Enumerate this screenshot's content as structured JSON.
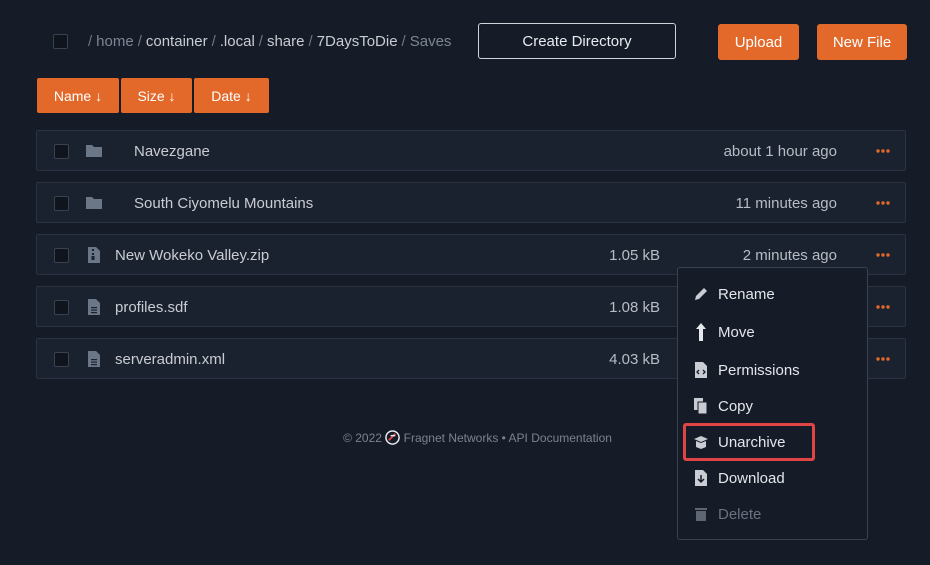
{
  "breadcrumb": {
    "sep": "/",
    "segments": [
      "home",
      "container",
      ".local",
      "share",
      "7DaysToDie",
      "Saves"
    ]
  },
  "toolbar": {
    "create_directory": "Create Directory",
    "upload": "Upload",
    "new_file": "New File"
  },
  "sort": {
    "name": "Name ↓",
    "size": "Size ↓",
    "date": "Date ↓"
  },
  "files": [
    {
      "name": "Navezgane",
      "size": "",
      "date": "about 1 hour ago",
      "type": "folder"
    },
    {
      "name": "South Ciyomelu Mountains",
      "size": "",
      "date": "11 minutes ago",
      "type": "folder"
    },
    {
      "name": "New Wokeko Valley.zip",
      "size": "1.05 kB",
      "date": "2 minutes ago",
      "type": "archive"
    },
    {
      "name": "profiles.sdf",
      "size": "1.08 kB",
      "date": "",
      "type": "file"
    },
    {
      "name": "serveradmin.xml",
      "size": "4.03 kB",
      "date": "",
      "type": "file"
    }
  ],
  "footer": {
    "copyright": "© 2022",
    "brand": "Fragnet Networks",
    "bullet": "•",
    "api": "API Documentation"
  },
  "context_menu": {
    "rename": "Rename",
    "move": "Move",
    "permissions": "Permissions",
    "copy": "Copy",
    "unarchive": "Unarchive",
    "download": "Download",
    "delete": "Delete"
  },
  "colors": {
    "background": "#151b27",
    "accent": "#e3692b",
    "highlight": "#e04444"
  }
}
